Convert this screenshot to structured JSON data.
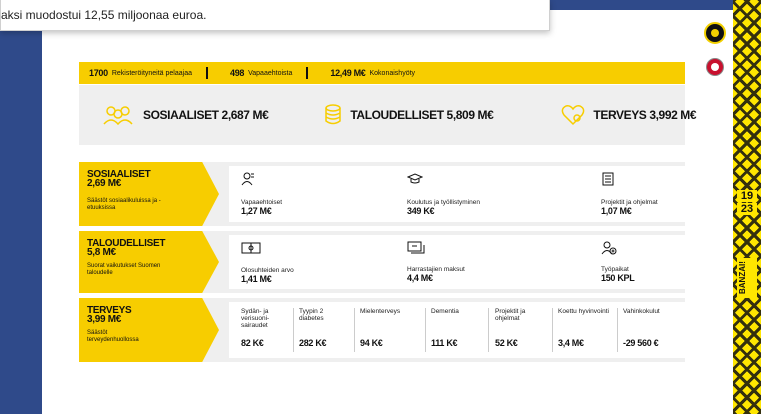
{
  "popup": {
    "text": "aksi muodostui 12,55 miljoonaa euroa."
  },
  "banner": {
    "items": [
      {
        "num": "1700",
        "label": "Rekisteröityneitä pelaajaa"
      },
      {
        "num": "498",
        "label": "Vapaaehtoista"
      },
      {
        "num": "12,49 M€",
        "label": "Kokonaishyöty"
      }
    ]
  },
  "summary": {
    "social": "SOSIAALISET 2,687 M€",
    "economic": "TALOUDELLISET 5,809 M€",
    "health": "TERVEYS 3,992 M€"
  },
  "rows": {
    "social": {
      "title": "SOSIAALISET\n2,69 M€",
      "title1": "SOSIAALISET",
      "title2": "2,69 M€",
      "sub": "Säästöt sosiaalikuluissa ja -etuuksissa",
      "cells": [
        {
          "label": "Vapaaehtoiset",
          "value": "1,27 M€",
          "icon": "people-icon"
        },
        {
          "label": "Koulutus ja työllistyminen",
          "value": "349 K€",
          "icon": "graduation-cap-icon"
        },
        {
          "label": "Projektit ja ohjelmat",
          "value": "1,07 M€",
          "icon": "document-icon"
        }
      ]
    },
    "economic": {
      "title1": "TALOUDELLISET",
      "title2": "5,8 M€",
      "sub": "Suorat vaikutukset Suomen taloudelle",
      "cells": [
        {
          "label": "Olosuhteiden arvo",
          "value": "1,41 M€",
          "icon": "field-icon"
        },
        {
          "label": "Harrastajien maksut",
          "value": "4,4 M€",
          "icon": "payment-icon"
        },
        {
          "label": "Työpaikat",
          "value": "150 KPL",
          "icon": "add-person-icon"
        }
      ]
    },
    "health": {
      "title1": "TERVEYS",
      "title2": "3,99 M€",
      "sub": "Säästöt terveydenhuollossa",
      "cells": [
        {
          "label": "Sydän- ja verisuoni-sairaudet",
          "value": "82 K€"
        },
        {
          "label": "Tyypin 2 diabetes",
          "value": "282 K€"
        },
        {
          "label": "Mielenterveys",
          "value": "94 K€"
        },
        {
          "label": "Dementia",
          "value": "111 K€"
        },
        {
          "label": "Projektit ja ohjelmat",
          "value": "52 K€"
        },
        {
          "label": "Koettu hyvinvointi",
          "value": "3,4 M€"
        },
        {
          "label": "Vahinkokulut",
          "value": "-29 560 €"
        }
      ]
    }
  },
  "strip": {
    "badge1": "19",
    "badge2": "23",
    "word": "BANZAI!"
  },
  "colors": {
    "yellow": "#f7cd00",
    "navy": "#2f4a8a",
    "panel": "#efefef"
  }
}
